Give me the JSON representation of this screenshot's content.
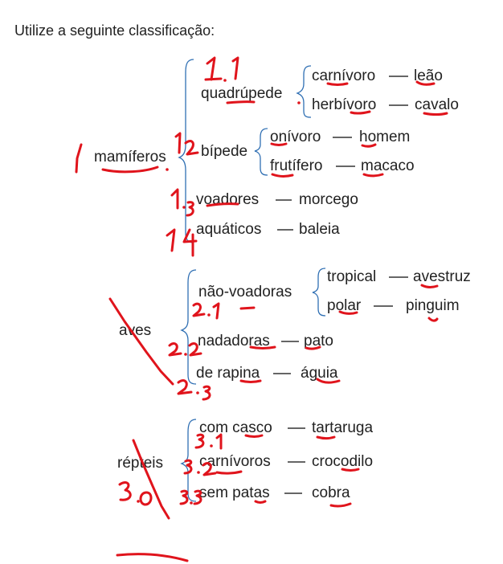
{
  "heading": "Utilize a seguinte classificação:",
  "groups": {
    "mamiferos": {
      "label": "mamíferos",
      "quadrupede": {
        "label": "quadrúpede",
        "sub": [
          {
            "type": "carnívoro",
            "animal": "leão"
          },
          {
            "type": "herbívoro",
            "animal": "cavalo"
          }
        ]
      },
      "bipede": {
        "label": "bípede",
        "sub": [
          {
            "type": "onívoro",
            "animal": "homem"
          },
          {
            "type": "frutífero",
            "animal": "macaco"
          }
        ]
      },
      "voadores": {
        "label": "voadores",
        "animal": "morcego"
      },
      "aquaticos": {
        "label": "aquáticos",
        "animal": "baleia"
      }
    },
    "aves": {
      "label": "aves",
      "nao_voadoras": {
        "label": "não-voadoras",
        "sub": [
          {
            "type": "tropical",
            "animal": "avestruz"
          },
          {
            "type": "polar",
            "animal": "pinguim"
          }
        ]
      },
      "nadadoras": {
        "label": "nadadoras",
        "animal": "pato"
      },
      "de_rapina": {
        "label": "de rapina",
        "animal": "águia"
      }
    },
    "repteis": {
      "label": "répteis",
      "com_casco": {
        "label": "com casco",
        "animal": "tartaruga"
      },
      "carnivoros": {
        "label": "carnívoros",
        "animal": "crocodilo"
      },
      "sem_patas": {
        "label": "sem patas",
        "animal": "cobra"
      }
    }
  },
  "annotations": {
    "color": "#e0141c",
    "marks": [
      "1",
      "1.1",
      "1.2",
      "1.3",
      "1.4",
      "2.1",
      "2.2",
      "2.3",
      "3.0",
      "3.1",
      "3.2",
      "3.3"
    ]
  }
}
